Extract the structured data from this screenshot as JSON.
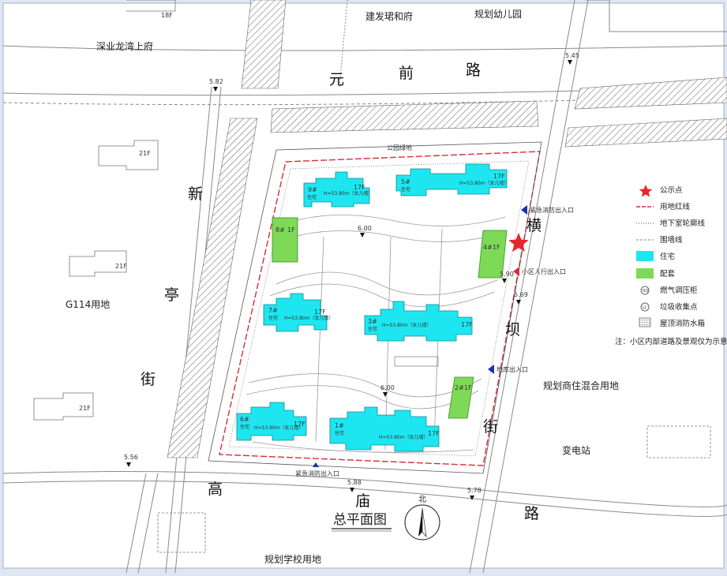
{
  "title": "总平面图",
  "north": "北",
  "roads": {
    "top": [
      "元",
      "前",
      "路"
    ],
    "left": [
      "新",
      "亭",
      "街"
    ],
    "right": [
      "横",
      "坝",
      "街"
    ],
    "bottom": [
      "高",
      "庙",
      "路"
    ]
  },
  "areas": {
    "shenye": "深业龙湾上府",
    "jianfa": "建发珺和府",
    "kindergarten": "规划幼儿园",
    "g114": "G114用地",
    "commercial": "规划商住混合用地",
    "substation": "变电站",
    "school": "规划学校用地",
    "park": "公园绿地"
  },
  "elevations": [
    "5.82",
    "5.45",
    "5.69",
    "5.90",
    "5.56",
    "5.88",
    "5.78",
    "6.00",
    "6.00"
  ],
  "floor_tags": [
    "18F",
    "21F",
    "21F",
    "21F"
  ],
  "buildings": [
    {
      "no": "9#",
      "use": "住宅",
      "floors": "17F",
      "height": "H=53.80m（女儿墙）"
    },
    {
      "no": "5#",
      "use": "住宅",
      "floors": "17F",
      "height": "H=53.80m（女儿墙）"
    },
    {
      "no": "7#",
      "use": "住宅",
      "floors": "17F",
      "height": "H=53.80m（女儿墙）"
    },
    {
      "no": "3#",
      "use": "住宅",
      "floors": "17F",
      "height": "H=53.80m（女儿墙）"
    },
    {
      "no": "6#",
      "use": "住宅",
      "floors": "17F",
      "height": "H=53.80m（女儿墙）"
    },
    {
      "no": "1#",
      "use": "住宅",
      "floors": "17F",
      "height": "H=53.80m（女儿墙）"
    }
  ],
  "support_buildings": [
    {
      "no": "8#",
      "floors": "1F"
    },
    {
      "no": "4#",
      "floors": "1F"
    },
    {
      "no": "2#",
      "floors": "1F"
    }
  ],
  "entrances": {
    "emergency_top": "紧急消防出入口",
    "pedestrian": "小区人行出入口",
    "vehicle": "地库出入口",
    "emergency_bottom": "紧急消防出入口"
  },
  "legend": [
    {
      "symbol": "star",
      "label": "公示点",
      "color": "#e8262b"
    },
    {
      "symbol": "redline",
      "label": "用地红线",
      "color": "#d0303a"
    },
    {
      "symbol": "dotted",
      "label": "地下室轮廓线",
      "color": "#555555"
    },
    {
      "symbol": "dashline",
      "label": "围墙线",
      "color": "#888888"
    },
    {
      "symbol": "cyan-box",
      "label": "住宅",
      "color": "#1ee6f0"
    },
    {
      "symbol": "green-box",
      "label": "配套",
      "color": "#7ed957"
    },
    {
      "symbol": "circle-mark",
      "label": "燃气调压柜",
      "color": "#444444"
    },
    {
      "symbol": "circle-mark",
      "label": "垃圾收集点",
      "color": "#444444"
    },
    {
      "symbol": "hatch-box",
      "label": "屋顶消防水箱",
      "color": "#444444"
    }
  ],
  "note": "注：小区内部道路及景观仅为示意"
}
